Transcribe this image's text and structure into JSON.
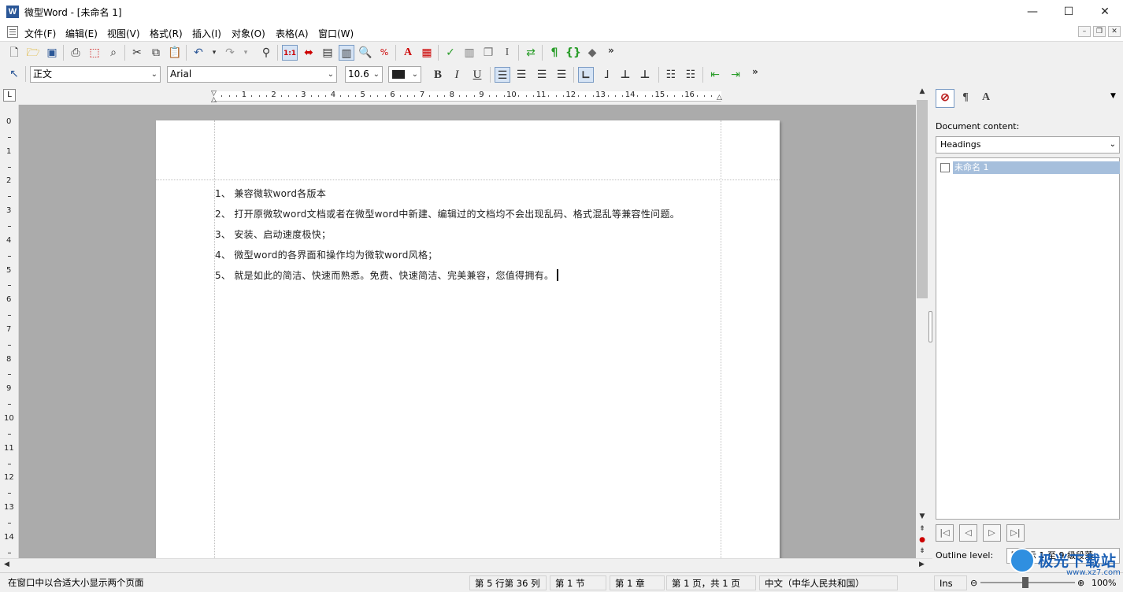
{
  "window": {
    "title": "微型Word - [未命名 1]",
    "app_icon_letter": "W",
    "minimize_glyph": "—",
    "maximize_glyph": "☐",
    "close_glyph": "✕"
  },
  "menubar": {
    "items": [
      "文件(F)",
      "编辑(E)",
      "视图(V)",
      "格式(R)",
      "插入(I)",
      "对象(O)",
      "表格(A)",
      "窗口(W)"
    ]
  },
  "toolbar_standard": {
    "icons": [
      "new-icon",
      "open-icon",
      "save-icon",
      "print-icon",
      "pdf-icon",
      "print-preview-icon",
      "cut-icon",
      "copy-icon",
      "paste-icon",
      "undo-icon",
      "redo-icon",
      "find-icon",
      "actual-size-icon",
      "page-width-icon",
      "one-page-icon",
      "two-pages-icon",
      "zoom-icon",
      "zoom-percent-icon",
      "text-color-icon",
      "frame-icon",
      "spell-check-icon",
      "columns-icon",
      "copy-format-icon",
      "text-box-icon",
      "replace-icon",
      "paragraph-marks-icon",
      "field-shading-icon",
      "layers-icon"
    ],
    "more": "»"
  },
  "toolbar_format": {
    "style": "正文",
    "font": "Arial",
    "size": "10.6",
    "color": "#222222",
    "bold": "B",
    "italic": "I",
    "underline": "U",
    "more": "»"
  },
  "ruler": {
    "corner": "L",
    "numbers": [
      "1",
      "2",
      "3",
      "4",
      "5",
      "6",
      "7",
      "8",
      "9",
      "10",
      "11",
      "12",
      "13",
      "14",
      "15",
      "16"
    ],
    "vertical_numbers": [
      "0",
      "1",
      "2",
      "3",
      "4",
      "5",
      "6",
      "7",
      "8",
      "9",
      "10",
      "11",
      "12",
      "13",
      "14"
    ]
  },
  "document": {
    "lines": [
      "1、 兼容微软word各版本",
      "2、 打开原微软word文档或者在微型word中新建、编辑过的文档均不会出现乱码、格式混乱等兼容性问题。",
      "3、 安装、启动速度极快；",
      "4、 微型word的各界面和操作均为微软word风格；",
      "5、 就是如此的简洁、快速而熟悉。免费、快速简洁、完美兼容，您值得拥有。"
    ]
  },
  "right_panel": {
    "content_label": "Document content:",
    "content_select": "Headings",
    "tree_items": [
      "未命名 1"
    ],
    "outline_label": "Outline level:",
    "outline_select": "只显示 1 至 9 级段落"
  },
  "statusbar": {
    "hint": "在窗口中以合适大小显示两个页面",
    "position": "第 5 行第 36 列",
    "section": "第 1 节",
    "chapter": "第 1 章",
    "page": "第 1 页，共 1 页",
    "language": "中文（中华人民共和国）",
    "mode": "Ins",
    "zoom": "100%"
  },
  "watermark": {
    "text": "极光下载站",
    "url": "www.xz7.com"
  }
}
